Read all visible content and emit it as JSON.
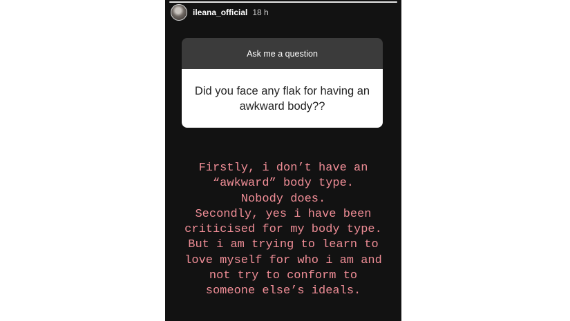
{
  "story": {
    "progress": 1.0,
    "username": "ileana_official",
    "timestamp": "18 h",
    "avatar_icon": "profile-photo"
  },
  "question_sticker": {
    "title": "Ask me a question",
    "question": "Did you face any flak for having an awkward body??"
  },
  "answer": {
    "lines": [
      "Firstly, i don’t have an",
      "“awkward” body type.",
      "Nobody does.",
      "Secondly, yes i have been",
      "criticised for my body type.",
      "But i am trying to learn to",
      "love myself for who i am and",
      "not try to conform to",
      "someone else’s ideals."
    ]
  },
  "colors": {
    "story_background": "#121212",
    "answer_text": "#ef8d96",
    "card_header": "#3b3b3b"
  }
}
